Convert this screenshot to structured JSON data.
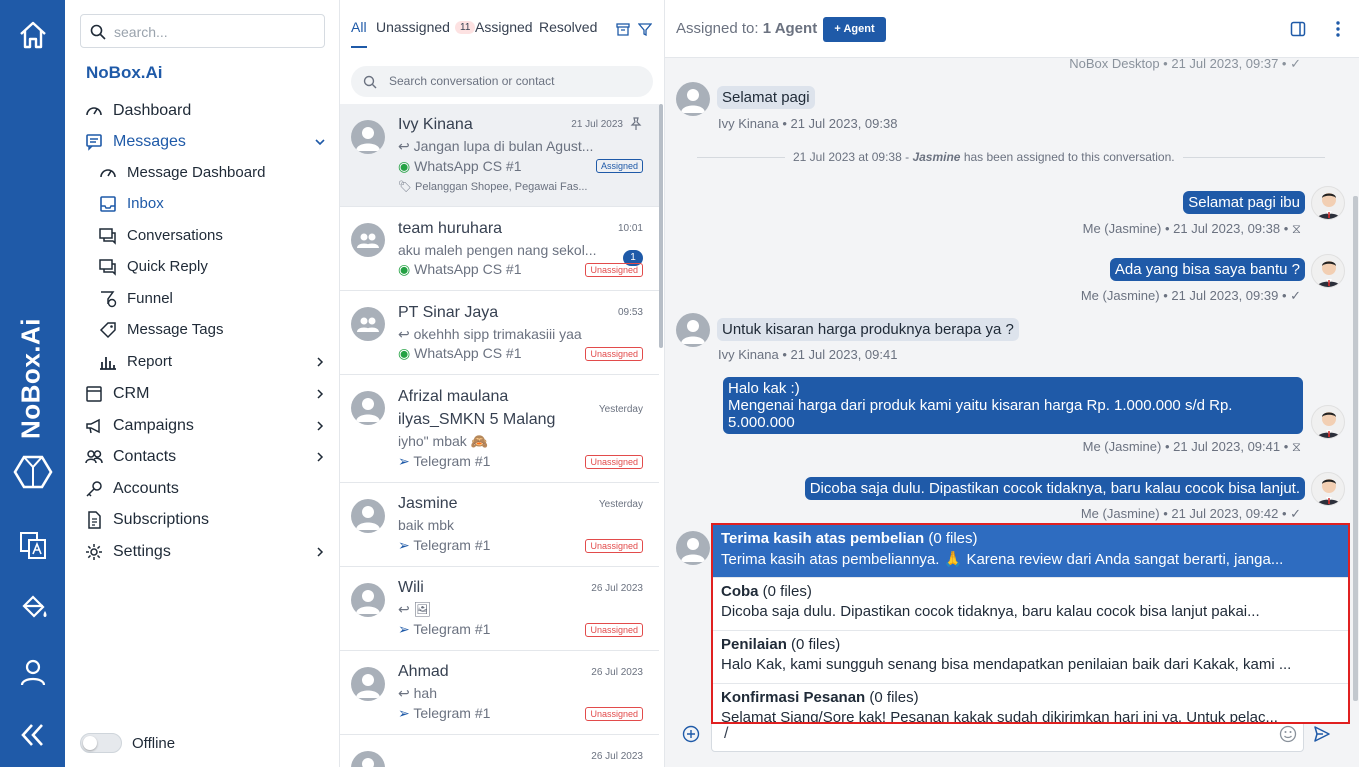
{
  "rail": {
    "brand": "NoBox.Ai"
  },
  "sidebar": {
    "search_placeholder": "search...",
    "org_name": "NoBox.Ai",
    "items": {
      "dashboard": "Dashboard",
      "messages": "Messages",
      "message_dashboard": "Message Dashboard",
      "inbox": "Inbox",
      "conversations": "Conversations",
      "quick_reply": "Quick Reply",
      "funnel": "Funnel",
      "message_tags": "Message Tags",
      "report": "Report",
      "crm": "CRM",
      "campaigns": "Campaigns",
      "contacts": "Contacts",
      "accounts": "Accounts",
      "subscriptions": "Subscriptions",
      "settings": "Settings"
    },
    "status_label": "Offline"
  },
  "conv_list": {
    "tabs": {
      "all": "All",
      "unassigned": "Unassigned",
      "unassigned_count": "11",
      "assigned": "Assigned",
      "resolved": "Resolved"
    },
    "search_placeholder": "Search conversation or contact",
    "items": [
      {
        "name": "Ivy Kinana",
        "time": "21 Jul 2023",
        "preview": "Jangan lupa di bulan Agust...",
        "channel": "WhatsApp CS #1",
        "status": "Assigned",
        "tags": "Pelanggan Shopee, Pegawai Fas..."
      },
      {
        "name": "team huruhara",
        "time": "10:01",
        "preview": "aku maleh pengen nang sekol...",
        "channel": "WhatsApp CS #1",
        "status": "Unassigned",
        "unread": "1"
      },
      {
        "name": "PT Sinar Jaya",
        "time": "09:53",
        "preview": "okehhh sipp trimakasiii yaa",
        "channel": "WhatsApp CS #1",
        "status": "Unassigned"
      },
      {
        "name_line1": "Afrizal maulana",
        "name_line2": "ilyas_SMKN 5 Malang",
        "time": "Yesterday",
        "preview": "iyho\" mbak 🙈",
        "channel": "Telegram #1",
        "status": "Unassigned"
      },
      {
        "name": "Jasmine",
        "time": "Yesterday",
        "preview": "baik mbk",
        "channel": "Telegram #1",
        "status": "Unassigned"
      },
      {
        "name": "Wili",
        "time": "26 Jul 2023",
        "preview": "🖼",
        "channel": "Telegram #1",
        "status": "Unassigned"
      },
      {
        "name": "Ahmad",
        "time": "26 Jul 2023",
        "preview": "hah",
        "channel": "Telegram #1",
        "status": "Unassigned"
      },
      {
        "name": "",
        "time": "26 Jul 2023"
      }
    ]
  },
  "chat": {
    "assigned_prefix": "Assigned to:",
    "assigned_value": "1 Agent",
    "add_agent": "+ Agent",
    "top_meta": "NoBox Desktop • 21 Jul 2023, 09:37 • ✓",
    "messages": [
      {
        "text": "Selamat pagi",
        "meta": "Ivy Kinana • 21 Jul 2023, 09:38"
      },
      {
        "text": "Selamat pagi ibu",
        "meta": "Me (Jasmine) • 21 Jul 2023, 09:38 • ⧖"
      },
      {
        "text": "Ada yang bisa saya bantu ?",
        "meta": "Me (Jasmine) • 21 Jul 2023, 09:39 • ✓"
      },
      {
        "text": "Untuk kisaran harga produknya berapa ya ?",
        "meta": "Ivy Kinana • 21 Jul 2023, 09:41"
      },
      {
        "line1": "Halo kak :)",
        "line2": "Mengenai harga dari produk kami yaitu kisaran harga Rp. 1.000.000 s/d Rp.",
        "line3": "5.000.000",
        "meta": "Me (Jasmine) • 21 Jul 2023, 09:41 • ⧖"
      },
      {
        "text": "Dicoba saja dulu. Dipastikan cocok tidaknya, baru kalau cocok bisa lanjut.",
        "meta": "Me (Jasmine) • 21 Jul 2023, 09:42 • ✓"
      }
    ],
    "system": {
      "prefix": "21 Jul 2023 at 09:38 -",
      "agent": "Jasmine",
      "suffix": "has been assigned to this conversation."
    },
    "quick_replies": [
      {
        "title": "Terima kasih atas pembelian",
        "files": "(0 files)",
        "desc": "Terima kasih atas pembeliannya. 🙏 Karena review dari Anda sangat berarti, janga..."
      },
      {
        "title": "Coba",
        "files": "(0 files)",
        "desc": "Dicoba saja dulu. Dipastikan cocok tidaknya, baru kalau cocok bisa lanjut pakai..."
      },
      {
        "title": "Penilaian",
        "files": "(0 files)",
        "desc": "Halo Kak, kami sungguh senang bisa mendapatkan penilaian baik dari Kakak, kami ..."
      },
      {
        "title": "Konfirmasi Pesanan",
        "files": "(0 files)",
        "desc": "Selamat Siang/Sore kak! Pesanan kakak sudah dikirimkan hari ini ya. Untuk pelac..."
      }
    ],
    "input_value": "/"
  },
  "colors": {
    "brand": "#1f5aa8",
    "highlight": "#2e6cc0",
    "alert": "#e24b4b"
  }
}
